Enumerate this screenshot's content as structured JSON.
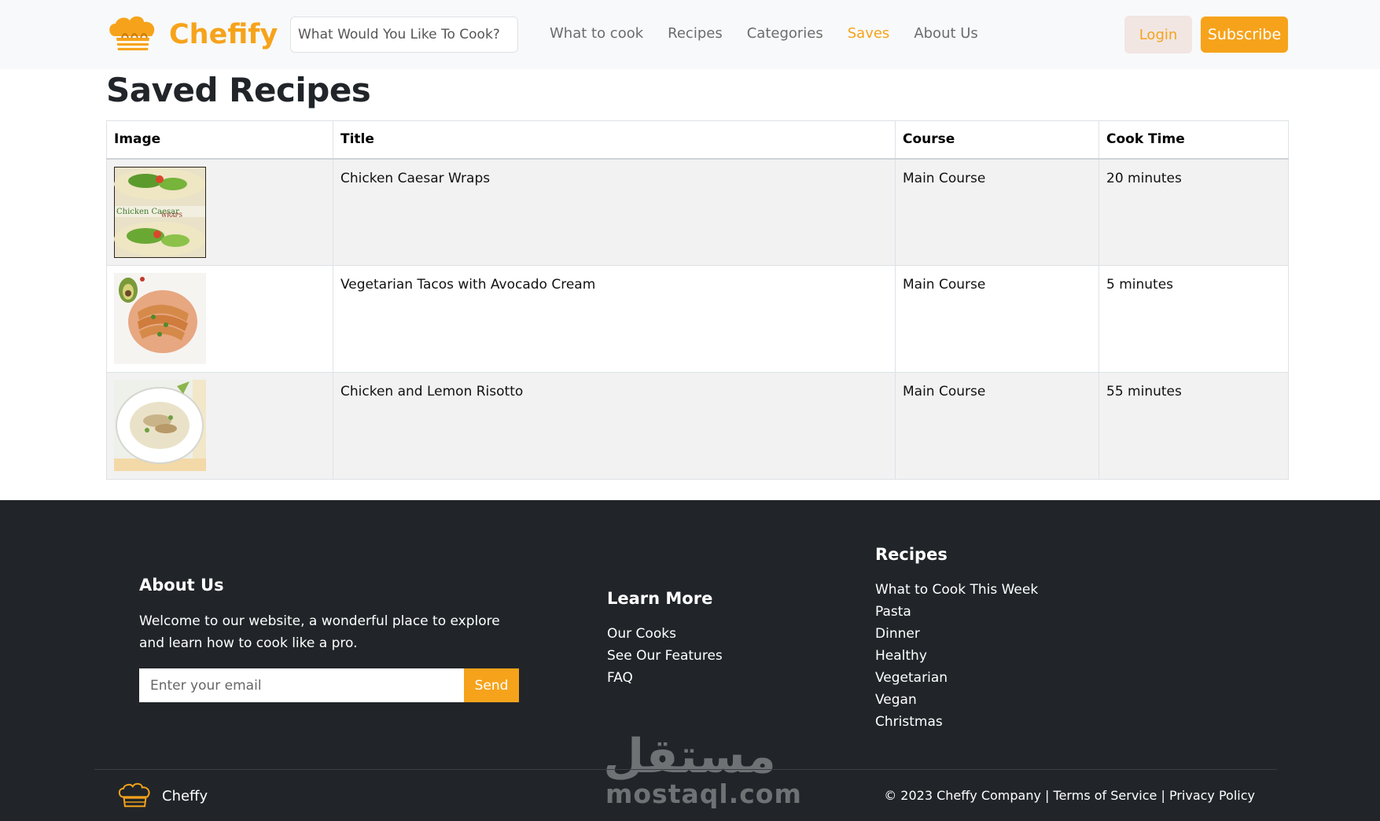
{
  "header": {
    "brand": "Chefify",
    "search_placeholder": "What Would You Like To Cook?",
    "nav": [
      {
        "label": "What to cook",
        "active": false
      },
      {
        "label": "Recipes",
        "active": false
      },
      {
        "label": "Categories",
        "active": false
      },
      {
        "label": "Saves",
        "active": true
      },
      {
        "label": "About Us",
        "active": false
      }
    ],
    "login_label": "Login",
    "subscribe_label": "Subscribe"
  },
  "main": {
    "title": "Saved Recipes",
    "table": {
      "columns": [
        "Image",
        "Title",
        "Course",
        "Cook Time"
      ],
      "rows": [
        {
          "image": "chicken-caesar-wraps-photo",
          "title": "Chicken Caesar Wraps",
          "course": "Main Course",
          "cook_time": "20 minutes"
        },
        {
          "image": "vegetarian-tacos-photo",
          "title": "Vegetarian Tacos with Avocado Cream",
          "course": "Main Course",
          "cook_time": "5 minutes"
        },
        {
          "image": "chicken-lemon-risotto-photo",
          "title": "Chicken and Lemon Risotto",
          "course": "Main Course",
          "cook_time": "55 minutes"
        }
      ]
    }
  },
  "footer": {
    "about": {
      "heading": "About Us",
      "text": "Welcome to our website, a wonderful place to explore and learn how to cook like a pro.",
      "email_placeholder": "Enter your email",
      "send_label": "Send"
    },
    "learn_more": {
      "heading": "Learn More",
      "links": [
        "Our Cooks",
        "See Our Features",
        "FAQ"
      ]
    },
    "recipes": {
      "heading": "Recipes",
      "links": [
        "What to Cook This Week",
        "Pasta",
        "Dinner",
        "Healthy",
        "Vegetarian",
        "Vegan",
        "Christmas"
      ]
    },
    "brand_name": "Cheffy",
    "copyright": "© 2023 Cheffy Company",
    "separator": "|",
    "terms": "Terms of Service",
    "privacy": "Privacy Policy",
    "watermark_arabic": "مستقل",
    "watermark_latin": "mostaql.com"
  },
  "colors": {
    "accent": "#f6a31b",
    "footer_bg": "#212529",
    "navbar_bg": "#f8f9fa"
  }
}
